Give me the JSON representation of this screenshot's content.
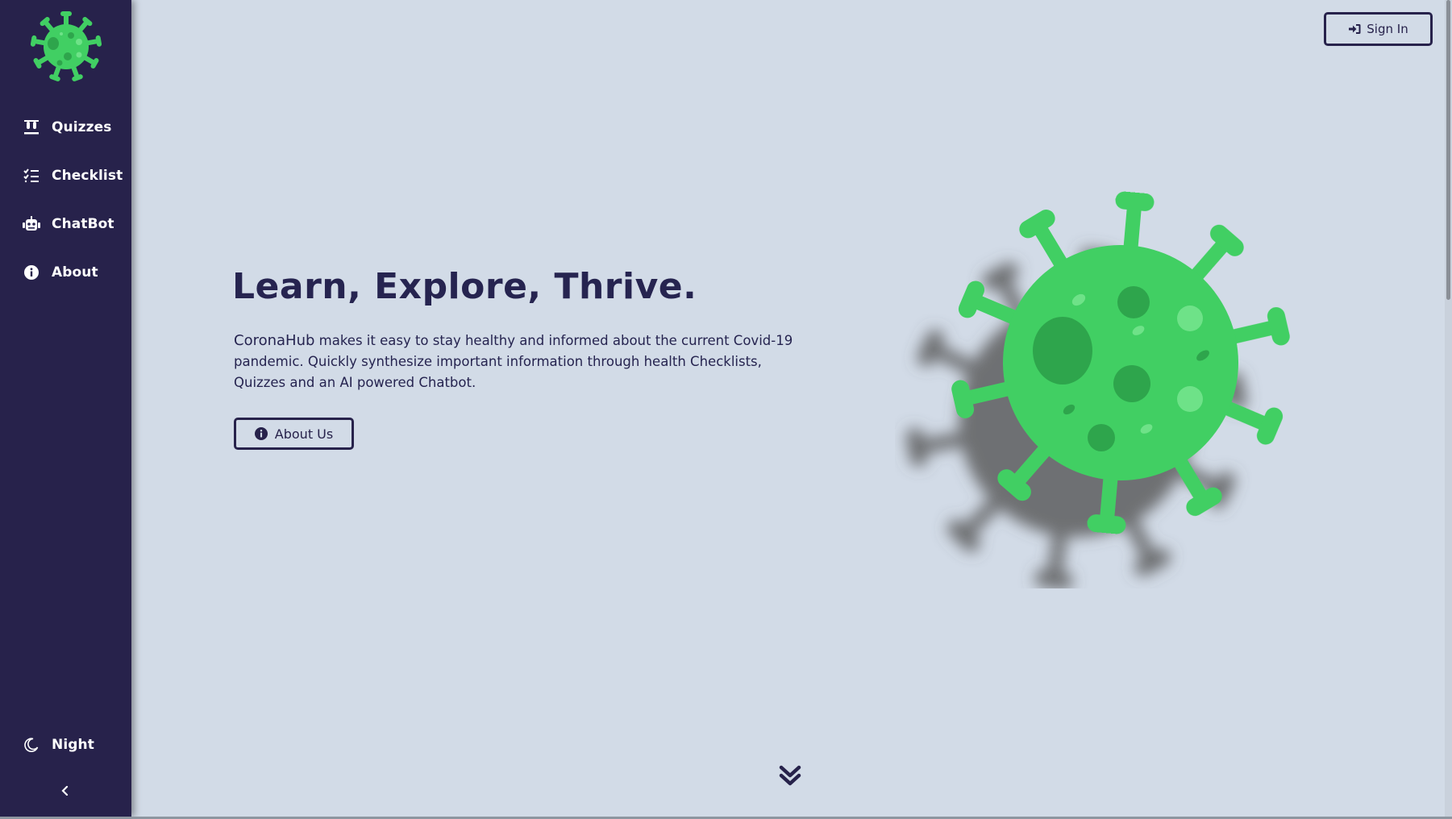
{
  "colors": {
    "sidebar_bg": "#27224b",
    "page_bg": "#d2dbe7",
    "virus_green": "#41cf63",
    "text_dark": "#262450"
  },
  "sidebar": {
    "logo_icon": "virus-icon",
    "items": [
      {
        "label": "Quizzes",
        "icon": "test-tubes-icon"
      },
      {
        "label": "Checklist",
        "icon": "tasks-icon"
      },
      {
        "label": "ChatBot",
        "icon": "robot-icon"
      },
      {
        "label": "About",
        "icon": "info-circle-icon"
      }
    ],
    "theme_toggle": {
      "label": "Night",
      "icon": "moon-icon"
    },
    "collapse_icon": "chevron-left-icon"
  },
  "header": {
    "sign_in_label": "Sign In",
    "sign_in_icon": "sign-in-icon"
  },
  "hero": {
    "title": "Learn, Explore, Thrive.",
    "brand": "CoronaHub",
    "description": " makes it easy to stay healthy and informed about the current Covid-19 pandemic. Quickly synthesize important information through health Checklists, Quizzes and an AI powered Chatbot.",
    "button_label": "About Us",
    "button_icon": "info-circle-icon",
    "illustration": "virus-illustration"
  },
  "scroll_down_icon": "double-chevron-down-icon"
}
